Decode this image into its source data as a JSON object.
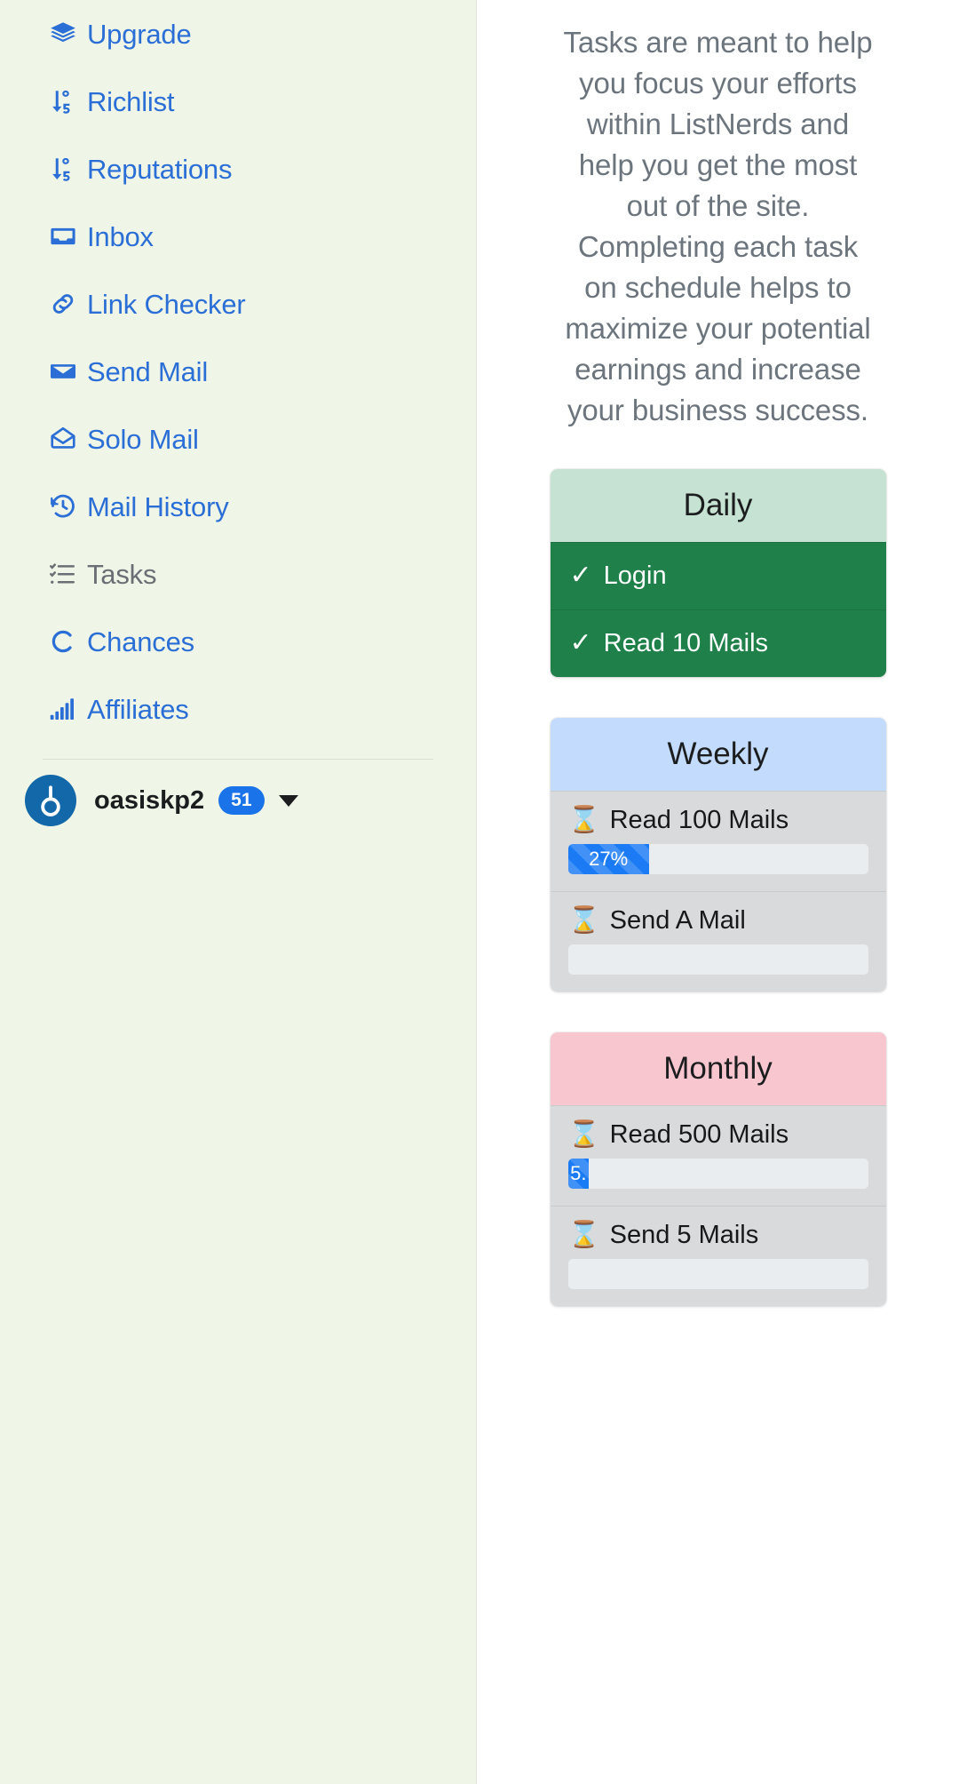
{
  "sidebar": {
    "items": [
      {
        "label": "Upgrade",
        "icon": "layers-icon",
        "active": false
      },
      {
        "label": "Richlist",
        "icon": "sort-numeric-icon",
        "active": false
      },
      {
        "label": "Reputations",
        "icon": "sort-numeric-icon",
        "active": false
      },
      {
        "label": "Inbox",
        "icon": "inbox-icon",
        "active": false
      },
      {
        "label": "Link Checker",
        "icon": "link-icon",
        "active": false
      },
      {
        "label": "Send Mail",
        "icon": "envelope-icon",
        "active": false
      },
      {
        "label": "Solo Mail",
        "icon": "envelope-open-icon",
        "active": false
      },
      {
        "label": "Mail History",
        "icon": "history-icon",
        "active": false
      },
      {
        "label": "Tasks",
        "icon": "task-list-icon",
        "active": true
      },
      {
        "label": "Chances",
        "icon": "circle-c-icon",
        "active": false
      },
      {
        "label": "Affiliates",
        "icon": "bar-chart-icon",
        "active": false
      }
    ],
    "user": {
      "name": "oasiskp2",
      "badge": "51",
      "avatar_icon": "power-swirl-icon",
      "caret_icon": "caret-down-icon"
    }
  },
  "main": {
    "intro": "Tasks are meant to help you focus your efforts within ListNerds and help you get the most out of the site. Completing each task on schedule helps to maximize your potential earnings and increase your business success.",
    "cards": [
      {
        "title": "Daily",
        "variant": "daily",
        "tasks": [
          {
            "label": "Login",
            "status": "done",
            "icon": "check-icon"
          },
          {
            "label": "Read 10 Mails",
            "status": "done",
            "icon": "check-icon"
          }
        ]
      },
      {
        "title": "Weekly",
        "variant": "weekly",
        "tasks": [
          {
            "label": "Read 100 Mails",
            "status": "pending",
            "icon": "hourglass-icon",
            "progress_percent": 27,
            "progress_text": "27%"
          },
          {
            "label": "Send A Mail",
            "status": "pending",
            "icon": "hourglass-icon",
            "progress_percent": 0,
            "progress_text": ""
          }
        ]
      },
      {
        "title": "Monthly",
        "variant": "monthly",
        "tasks": [
          {
            "label": "Read 500 Mails",
            "status": "pending",
            "icon": "hourglass-icon",
            "progress_percent": 7,
            "progress_text": "5."
          },
          {
            "label": "Send 5 Mails",
            "status": "pending",
            "icon": "hourglass-icon",
            "progress_percent": 0,
            "progress_text": ""
          }
        ]
      }
    ]
  },
  "colors": {
    "link_blue": "#2b6fd6",
    "sidebar_bg": "#eff6e7",
    "muted_text": "#6c757d",
    "done_green": "#1f8049",
    "daily_header": "#c5e2d2",
    "weekly_header": "#c3dcfd",
    "monthly_header": "#f7c6ce",
    "progress_blue": "#1a7bf5",
    "badge_blue": "#1a73e8"
  }
}
